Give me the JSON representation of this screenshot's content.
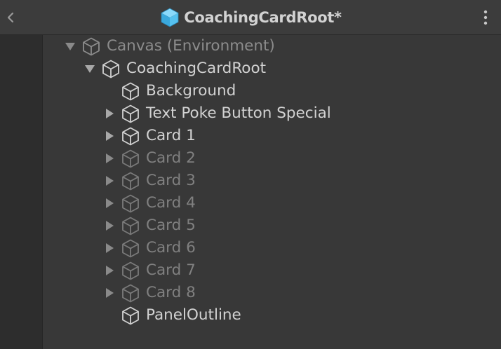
{
  "header": {
    "title": "CoachingCardRoot*",
    "title_icon": "prefab-cube-icon",
    "back_icon": "chevron-left-icon",
    "menu_icon": "vertical-dots-menu-icon"
  },
  "colors": {
    "background": "#383838",
    "header": "#3c3c3c",
    "gutter": "#2d2d2d",
    "text_active": "#d2d2d2",
    "text_inactive": "#8c8c8c",
    "prefab_blue": "#4fc3f7"
  },
  "hierarchy": [
    {
      "label": "Canvas (Environment)",
      "depth": 0,
      "expandable": true,
      "expanded": true,
      "active": false
    },
    {
      "label": "CoachingCardRoot",
      "depth": 1,
      "expandable": true,
      "expanded": true,
      "active": true
    },
    {
      "label": "Background",
      "depth": 2,
      "expandable": false,
      "expanded": false,
      "active": true
    },
    {
      "label": "Text Poke Button Special",
      "depth": 2,
      "expandable": true,
      "expanded": false,
      "active": true
    },
    {
      "label": "Card 1",
      "depth": 2,
      "expandable": true,
      "expanded": false,
      "active": true
    },
    {
      "label": "Card 2",
      "depth": 2,
      "expandable": true,
      "expanded": false,
      "active": false
    },
    {
      "label": "Card 3",
      "depth": 2,
      "expandable": true,
      "expanded": false,
      "active": false
    },
    {
      "label": "Card 4",
      "depth": 2,
      "expandable": true,
      "expanded": false,
      "active": false
    },
    {
      "label": "Card 5",
      "depth": 2,
      "expandable": true,
      "expanded": false,
      "active": false
    },
    {
      "label": "Card 6",
      "depth": 2,
      "expandable": true,
      "expanded": false,
      "active": false
    },
    {
      "label": "Card 7",
      "depth": 2,
      "expandable": true,
      "expanded": false,
      "active": false
    },
    {
      "label": "Card 8",
      "depth": 2,
      "expandable": true,
      "expanded": false,
      "active": false
    },
    {
      "label": "PanelOutline",
      "depth": 2,
      "expandable": false,
      "expanded": false,
      "active": true
    }
  ]
}
